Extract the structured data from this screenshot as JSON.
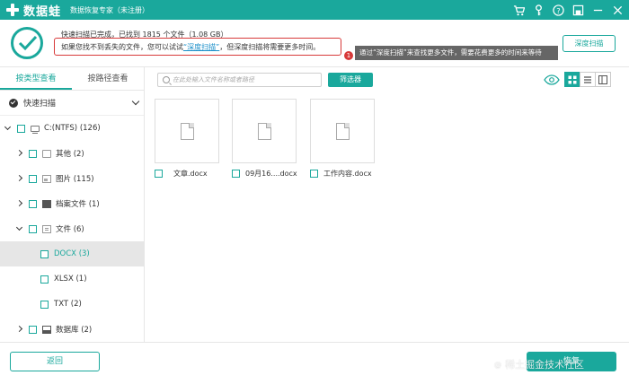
{
  "titlebar": {
    "brand": "数据蛙",
    "app_title": "数据恢复专家（未注册）",
    "icons": [
      "cart-icon",
      "key-icon",
      "help-icon",
      "save-icon",
      "minimize-icon",
      "close-icon"
    ]
  },
  "status": {
    "scan_result": "快速扫描已完成，已找到 1815 个文件（1.08 GB）",
    "hint_before": "如果您找不到丢失的文件，您可以试试",
    "hint_link": "“深度扫描”",
    "hint_after": "，但深度扫描将需要更多时间。",
    "badge": "1",
    "tooltip": "通过“深度扫描”来查找更多文件，需要花费更多的时间来等待",
    "deep_scan_button": "深度扫描"
  },
  "sidebar": {
    "tabs": [
      {
        "label": "按类型查看",
        "active": true
      },
      {
        "label": "按路径查看",
        "active": false
      }
    ],
    "scan_mode": "快速扫描",
    "tree": [
      {
        "label": "C:(NTFS) (126)",
        "level": 0,
        "arrow": "down",
        "icon": "drive-icon"
      },
      {
        "label": "其他 (2)",
        "level": 1,
        "arrow": "right",
        "icon": "folder-icon"
      },
      {
        "label": "图片 (115)",
        "level": 1,
        "arrow": "right",
        "icon": "image-icon"
      },
      {
        "label": "档案文件 (1)",
        "level": 1,
        "arrow": "right",
        "icon": "archive-icon"
      },
      {
        "label": "文件 (6)",
        "level": 1,
        "arrow": "down",
        "icon": "document-icon"
      },
      {
        "label": "DOCX (3)",
        "level": 2,
        "arrow": "",
        "icon": "",
        "selected": true
      },
      {
        "label": "XLSX (1)",
        "level": 2,
        "arrow": "",
        "icon": ""
      },
      {
        "label": "TXT (2)",
        "level": 2,
        "arrow": "",
        "icon": ""
      },
      {
        "label": "数据库 (2)",
        "level": 1,
        "arrow": "right",
        "icon": "database-icon"
      }
    ]
  },
  "toolbar": {
    "search_placeholder": "在此处输入文件名称或者路径",
    "filter_button": "筛选器"
  },
  "files": [
    {
      "name": "文章.docx"
    },
    {
      "name": "09月16....docx"
    },
    {
      "name": "工作内容.docx"
    }
  ],
  "footer": {
    "back_button": "返回",
    "recover_button": "恢复",
    "watermark": "稀土掘金技术社区"
  },
  "colors": {
    "accent": "#1aa89c",
    "alert": "#d83a3a",
    "link": "#1a8fc9"
  }
}
